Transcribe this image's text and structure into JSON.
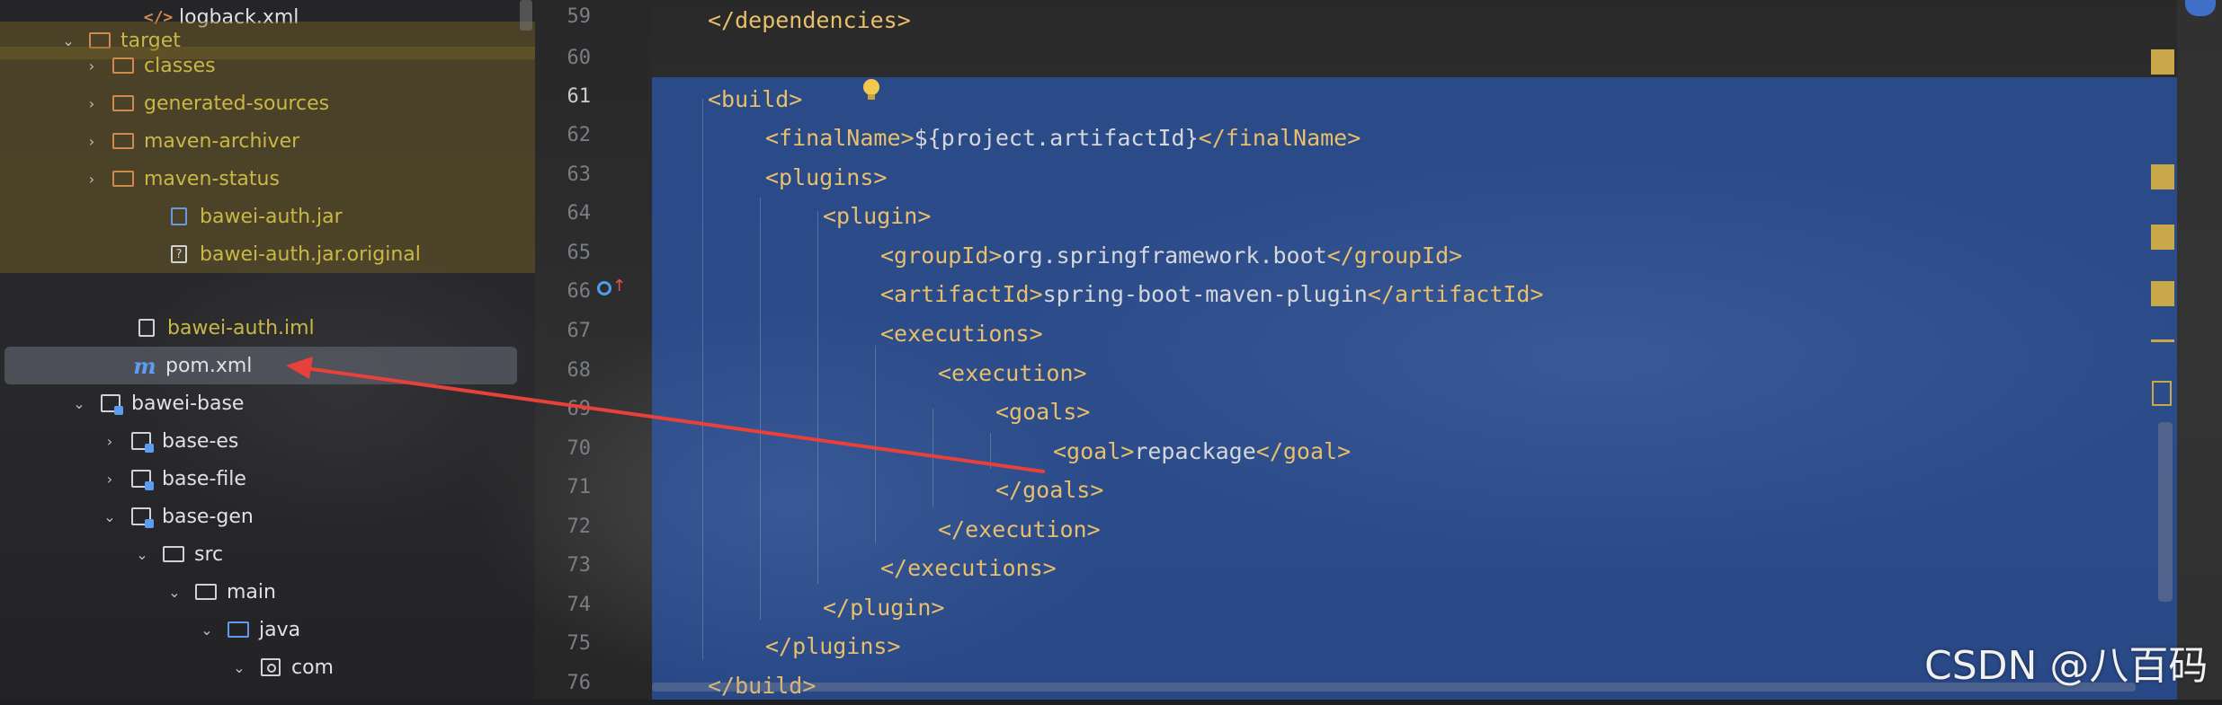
{
  "project_tree": {
    "items": [
      {
        "label": "logback.xml"
      },
      {
        "label": "target"
      },
      {
        "label": "classes"
      },
      {
        "label": "generated-sources"
      },
      {
        "label": "maven-archiver"
      },
      {
        "label": "maven-status"
      },
      {
        "label": "bawei-auth.jar"
      },
      {
        "label": "bawei-auth.jar.original"
      },
      {
        "label": "bawei-auth.iml"
      },
      {
        "label": "pom.xml"
      },
      {
        "label": "bawei-base"
      },
      {
        "label": "base-es"
      },
      {
        "label": "base-file"
      },
      {
        "label": "base-gen"
      },
      {
        "label": "src"
      },
      {
        "label": "main"
      },
      {
        "label": "java"
      },
      {
        "label": "com"
      }
    ]
  },
  "editor": {
    "current_line": "61",
    "lines": [
      {
        "num": "59",
        "code": "</dependencies>"
      },
      {
        "num": "60",
        "code": ""
      },
      {
        "num": "61",
        "code": "<build>"
      },
      {
        "num": "62",
        "open": "<finalName>",
        "text": "${project.artifactId}",
        "close": "</finalName>"
      },
      {
        "num": "63",
        "code": "<plugins>"
      },
      {
        "num": "64",
        "code": "<plugin>"
      },
      {
        "num": "65",
        "open": "<groupId>",
        "text": "org.springframework.boot",
        "close": "</groupId>"
      },
      {
        "num": "66",
        "open": "<artifactId>",
        "text": "spring-boot-maven-plugin",
        "close": "</artifactId>"
      },
      {
        "num": "67",
        "code": "<executions>"
      },
      {
        "num": "68",
        "code": "<execution>"
      },
      {
        "num": "69",
        "code": "<goals>"
      },
      {
        "num": "70",
        "open": "<goal>",
        "text": "repackage",
        "close": "</goal>"
      },
      {
        "num": "71",
        "code": "</goals>"
      },
      {
        "num": "72",
        "code": "</execution>"
      },
      {
        "num": "73",
        "code": "</executions>"
      },
      {
        "num": "74",
        "code": "</plugin>"
      },
      {
        "num": "75",
        "code": "</plugins>"
      },
      {
        "num": "76",
        "code": "</build>"
      }
    ]
  },
  "icons": {
    "intention": "lightbulb-icon",
    "gutter": "override-method-icon"
  },
  "colors": {
    "selection": "#2b56ac",
    "xml_tag": "#e8bf6a",
    "excluded_folder_text": "#c9b845",
    "annotation_arrow": "#e8403a"
  },
  "watermark": "CSDN @八百码"
}
